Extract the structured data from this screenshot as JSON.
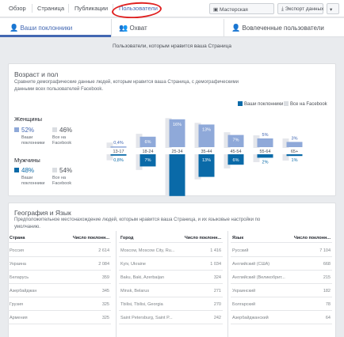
{
  "nav": {
    "items": [
      "Обзор",
      "Страница",
      "Публикации",
      "Пользователи"
    ],
    "creative_hub": "Мастерская",
    "export": "Экспорт данных"
  },
  "tabs": [
    "Ваши поклонники",
    "Охват",
    "Вовлеченные пользователи"
  ],
  "subtitle": "Пользователи, которым нравится ваша Страница",
  "age_gender": {
    "title": "Возраст и пол",
    "description": "Сравните демографические данные людей, которым нравится ваша Страница, с демографическими данными всех пользователей Facebook.",
    "legend_fans": "Ваши поклонники",
    "legend_all": "Все на Facebook",
    "women": {
      "title": "Женщины",
      "fans_pct": "52%",
      "all_pct": "46%"
    },
    "men": {
      "title": "Мужчины",
      "fans_pct": "48%",
      "all_pct": "54%"
    },
    "fans_label": "Ваши поклонники",
    "all_label": "Все на Facebook",
    "colors": {
      "women_fans": "#8fa9d9",
      "women_all": "#e4e6eb",
      "men_fans": "#0a6aa8",
      "men_all": "#e4e6eb"
    }
  },
  "chart_data": {
    "type": "bar",
    "categories": [
      "13-17",
      "18-24",
      "25-34",
      "35-44",
      "45-54",
      "55-64",
      "65+"
    ],
    "series": [
      {
        "name": "Женщины",
        "values": [
          0.4,
          6,
          16,
          13,
          7,
          5,
          3
        ]
      },
      {
        "name": "Мужчины",
        "values": [
          0.8,
          7,
          24,
          13,
          6,
          2,
          1
        ]
      }
    ],
    "labels_women": [
      "0,4%",
      "6%",
      "16%",
      "13%",
      "7%",
      "5%",
      "3%"
    ],
    "labels_men": [
      "0,8%",
      "7%",
      "",
      "13%",
      "6%",
      "2%",
      "1%"
    ]
  },
  "geo": {
    "title": "География и Язык",
    "description": "Предположительное местонахождение людей, которым нравится ваша Страница, и их языковые настройки по умолчанию.",
    "countries": {
      "headers": [
        "Страна",
        "Число поклонн..."
      ],
      "rows": [
        [
          "Россия",
          "2 614"
        ],
        [
          "Украина",
          "2 084"
        ],
        [
          "Беларусь",
          "359"
        ],
        [
          "Азербайджан",
          "345"
        ],
        [
          "Грузия",
          "325"
        ],
        [
          "Армения",
          "325"
        ]
      ]
    },
    "cities": {
      "headers": [
        "Город",
        "Число поклонн..."
      ],
      "rows": [
        [
          "Moscow, Moscow City, Ru...",
          "1 416"
        ],
        [
          "Kyiv, Ukraine",
          "1 034"
        ],
        [
          "Baku, Baki, Azerbaijan",
          "324"
        ],
        [
          "Minsk, Belarus",
          "271"
        ],
        [
          "Tbilisi, Tbilisi, Georgia",
          "270"
        ],
        [
          "Saint Petersburg, Saint P...",
          "242"
        ]
      ]
    },
    "languages": {
      "headers": [
        "Язык",
        "Число поклонн..."
      ],
      "rows": [
        [
          "Русский",
          "7 104"
        ],
        [
          "Английский (США)",
          "668"
        ],
        [
          "Английский (Великобрит...",
          "215"
        ],
        [
          "Украинский",
          "182"
        ],
        [
          "Болгарский",
          "78"
        ],
        [
          "Азербайджанский",
          "64"
        ]
      ]
    }
  }
}
